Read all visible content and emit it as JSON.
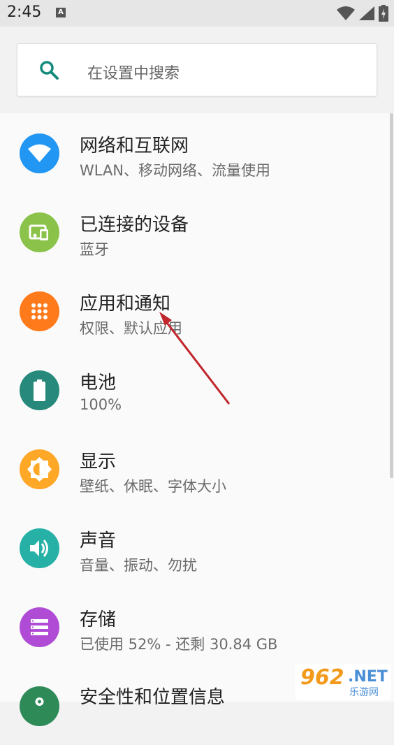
{
  "status_bar": {
    "time": "2:45",
    "notif_letter": "A"
  },
  "search": {
    "placeholder": "在设置中搜索"
  },
  "items": [
    {
      "title": "网络和互联网",
      "subtitle": "WLAN、移动网络、流量使用",
      "icon": "wifi-icon",
      "color": "#2196f3"
    },
    {
      "title": "已连接的设备",
      "subtitle": "蓝牙",
      "icon": "devices-icon",
      "color": "#8bc34a"
    },
    {
      "title": "应用和通知",
      "subtitle": "权限、默认应用",
      "icon": "apps-icon",
      "color": "#ff7a1a"
    },
    {
      "title": "电池",
      "subtitle": "100%",
      "icon": "battery-icon",
      "color": "#26897b"
    },
    {
      "title": "显示",
      "subtitle": "壁纸、休眠、字体大小",
      "icon": "brightness-icon",
      "color": "#ffa726"
    },
    {
      "title": "声音",
      "subtitle": "音量、振动、勿扰",
      "icon": "volume-icon",
      "color": "#26b0a6"
    },
    {
      "title": "存储",
      "subtitle": "已使用 52% - 还剩 30.84 GB",
      "icon": "storage-icon",
      "color": "#b04bd6"
    },
    {
      "title": "安全性和位置信息",
      "subtitle": "",
      "icon": "lock-icon",
      "color": "#2e8b57"
    }
  ],
  "watermark": {
    "num": "962",
    "net": ".NET",
    "cn": "乐游网"
  }
}
